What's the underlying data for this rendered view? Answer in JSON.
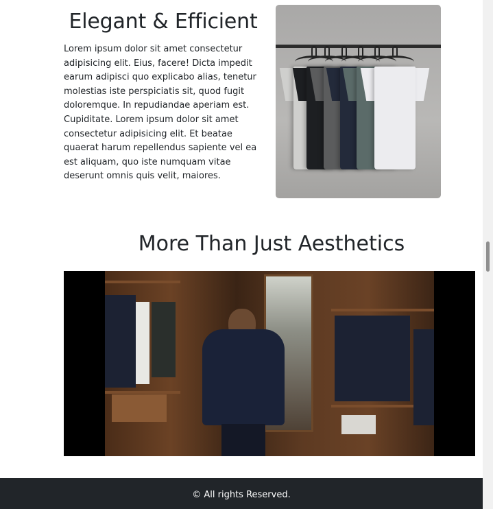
{
  "feature": {
    "title": "Elegant & Efficient",
    "text": "Lorem ipsum dolor sit amet consectetur adipisicing elit. Eius, facere! Dicta impedit earum adipisci quo explicabo alias, tenetur molestias iste perspiciatis sit, quod fugit doloremque. In repudiandae aperiam est. Cupiditate. Lorem ipsum dolor sit amet consectetur adipisicing elit. Et beatae quaerat harum repellendus sapiente vel ea est aliquam, quo iste numquam vitae deserunt omnis quis velit, maiores.",
    "image": {
      "shirt_colors": [
        "#cfcfcd",
        "#1d1f22",
        "#5b5c5d",
        "#232a3a",
        "#5b6b69",
        "#ececef"
      ]
    }
  },
  "section": {
    "title": "More Than Just Aesthetics"
  },
  "footer": {
    "text": "© All rights Reserved."
  }
}
